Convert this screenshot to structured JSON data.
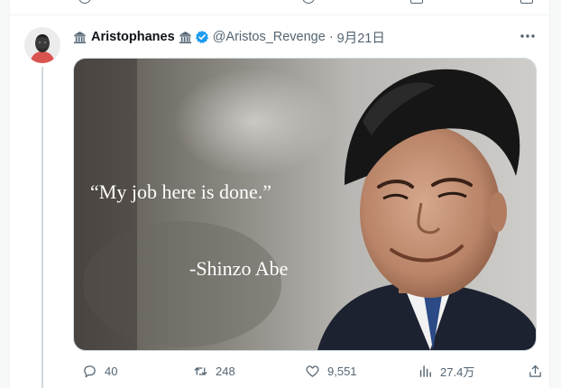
{
  "tweet": {
    "display_name": "Aristophanes",
    "handle": "@Aristos_Revenge",
    "separator": "·",
    "timestamp": "9月21日",
    "name_emoji": "classical-building-emoji",
    "verified_color": "#1d9bf0"
  },
  "media": {
    "quote": "“My job here is done.”",
    "attribution": "-Shinzo Abe"
  },
  "actions": {
    "reply_count": "40",
    "retweet_count": "248",
    "like_count": "9,551",
    "views_count": "27.4万"
  },
  "colors": {
    "secondary_text": "#536471",
    "accent": "#1d9bf0",
    "border": "#cfd9de"
  }
}
